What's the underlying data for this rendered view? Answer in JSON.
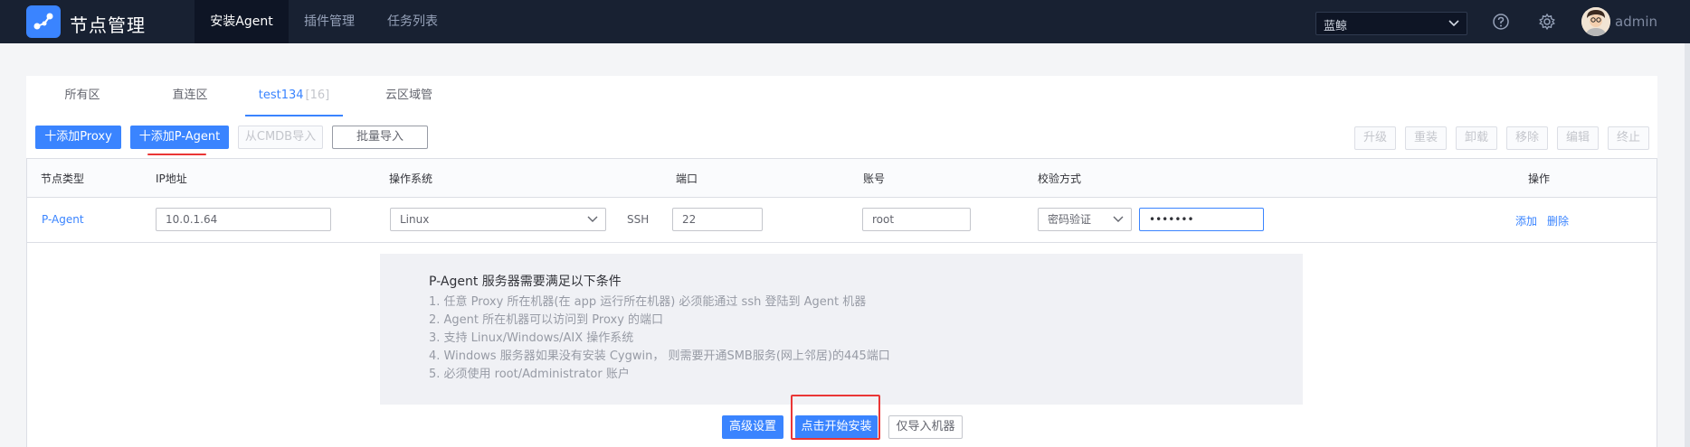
{
  "header": {
    "title": "节点管理",
    "nav": [
      "安装Agent",
      "插件管理",
      "任务列表"
    ],
    "business_select": "蓝鲸",
    "user": "admin"
  },
  "tabs": [
    {
      "label": "所有区域",
      "count": ""
    },
    {
      "label": "直连区域",
      "count": ""
    },
    {
      "label": "test134",
      "count": "[16]"
    },
    {
      "label": "云区域管理",
      "count": ""
    }
  ],
  "toolbar": {
    "add_proxy": "十添加Proxy",
    "add_pagent": "十添加P-Agent",
    "import_cmdb": "从CMDB导入",
    "batch_import": "批量导入",
    "actions": [
      "升级",
      "重装",
      "卸载",
      "移除",
      "编辑",
      "终止"
    ]
  },
  "table": {
    "headers": [
      "节点类型",
      "IP地址",
      "操作系统",
      "端口",
      "账号",
      "校验方式",
      "操作"
    ],
    "row": {
      "node_type": "P-Agent",
      "ip": "10.0.1.64",
      "os": "Linux",
      "protocol": "SSH",
      "port": "22",
      "account": "root",
      "auth_method": "密码验证",
      "password": "•••••••",
      "add": "添加",
      "delete": "删除"
    }
  },
  "conditions": {
    "title": "P-Agent 服务器需要满足以下条件",
    "items": [
      "1. 任意 Proxy 所在机器(在 app 运行所在机器) 必须能通过 ssh 登陆到 Agent 机器",
      "2. Agent 所在机器可以访问到 Proxy 的端口",
      "3. 支持 Linux/Windows/AIX 操作系统",
      "4. Windows 服务器如果没有安装 Cygwin， 则需要开通SMB服务(网上邻居)的445端口",
      "5. 必须使用 root/Administrator 账户"
    ]
  },
  "footer": {
    "advanced": "高级设置",
    "start_install": "点击开始安装",
    "import_only": "仅导入机器"
  },
  "colors": {
    "primary": "#3a84ff",
    "topbar": "#182132",
    "highlight": "#ea3636"
  }
}
